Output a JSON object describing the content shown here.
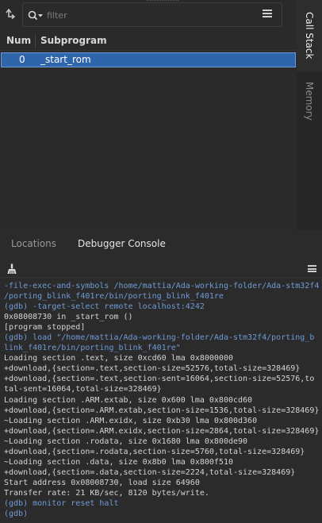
{
  "toolbar": {
    "refresh_icon": "step-return-icon",
    "filter_icon": "search-icon",
    "filter_placeholder": "filter",
    "menu_icon": "hamburger-menu-icon"
  },
  "table": {
    "headers": {
      "num": "Num",
      "subprogram": "Subprogram"
    },
    "rows": [
      {
        "num": "0",
        "subprogram": "_start_rom"
      }
    ]
  },
  "side_tabs": {
    "call_stack": "Call Stack",
    "memory": "Memory"
  },
  "bottom_tabs": {
    "locations": "Locations",
    "debugger_console": "Debugger Console"
  },
  "console_toolbar": {
    "clear_icon": "broom-icon",
    "menu_icon": "hamburger-menu-icon"
  },
  "console": {
    "lines": [
      {
        "text": "-file-exec-and-symbols /home/mattia/Ada-working-folder/Ada-stm32f4",
        "type": "cmd"
      },
      {
        "text": "/porting_blink_f401re/bin/porting_blink_f401re",
        "type": "cmd"
      },
      {
        "text": "(gdb) -target-select remote localhost:4242",
        "type": "cmd"
      },
      {
        "text": "0x08008730 in _start_rom ()",
        "type": "out"
      },
      {
        "text": "[program stopped]",
        "type": "out"
      },
      {
        "text": "(gdb) load \"/home/mattia/Ada-working-folder/Ada-stm32f4/porting_b",
        "type": "cmd"
      },
      {
        "text": "link_f401re/bin/porting_blink_f401re\"",
        "type": "cmd"
      },
      {
        "text": "Loading section .text, size 0xcd60 lma 0x8000000",
        "type": "out"
      },
      {
        "text": "+download,{section=.text,section-size=52576,total-size=328469}",
        "type": "out"
      },
      {
        "text": "+download,{section=.text,section-sent=16064,section-size=52576,to",
        "type": "out"
      },
      {
        "text": "tal-sent=16064,total-size=328469}",
        "type": "out"
      },
      {
        "text": "Loading section .ARM.extab, size 0x600 lma 0x800cd60",
        "type": "out"
      },
      {
        "text": "+download,{section=.ARM.extab,section-size=1536,total-size=328469}",
        "type": "out"
      },
      {
        "text": "~Loading section .ARM.exidx, size 0xb30 lma 0x800d360",
        "type": "out"
      },
      {
        "text": "+download,{section=.ARM.exidx,section-size=2864,total-size=328469}",
        "type": "out"
      },
      {
        "text": "~Loading section .rodata, size 0x1680 lma 0x800de90",
        "type": "out"
      },
      {
        "text": "+download,{section=.rodata,section-size=5760,total-size=328469}",
        "type": "out"
      },
      {
        "text": "~Loading section .data, size 0x8b0 lma 0x800f510",
        "type": "out"
      },
      {
        "text": "+download,{section=.data,section-size=2224,total-size=328469}",
        "type": "out"
      },
      {
        "text": "Start address 0x08008730, load size 64960",
        "type": "out"
      },
      {
        "text": "Transfer rate: 21 KB/sec, 8120 bytes/write.",
        "type": "out"
      },
      {
        "text": "(gdb) monitor reset halt",
        "type": "cmd"
      },
      {
        "text": "(gdb)",
        "type": "cmd"
      }
    ]
  }
}
